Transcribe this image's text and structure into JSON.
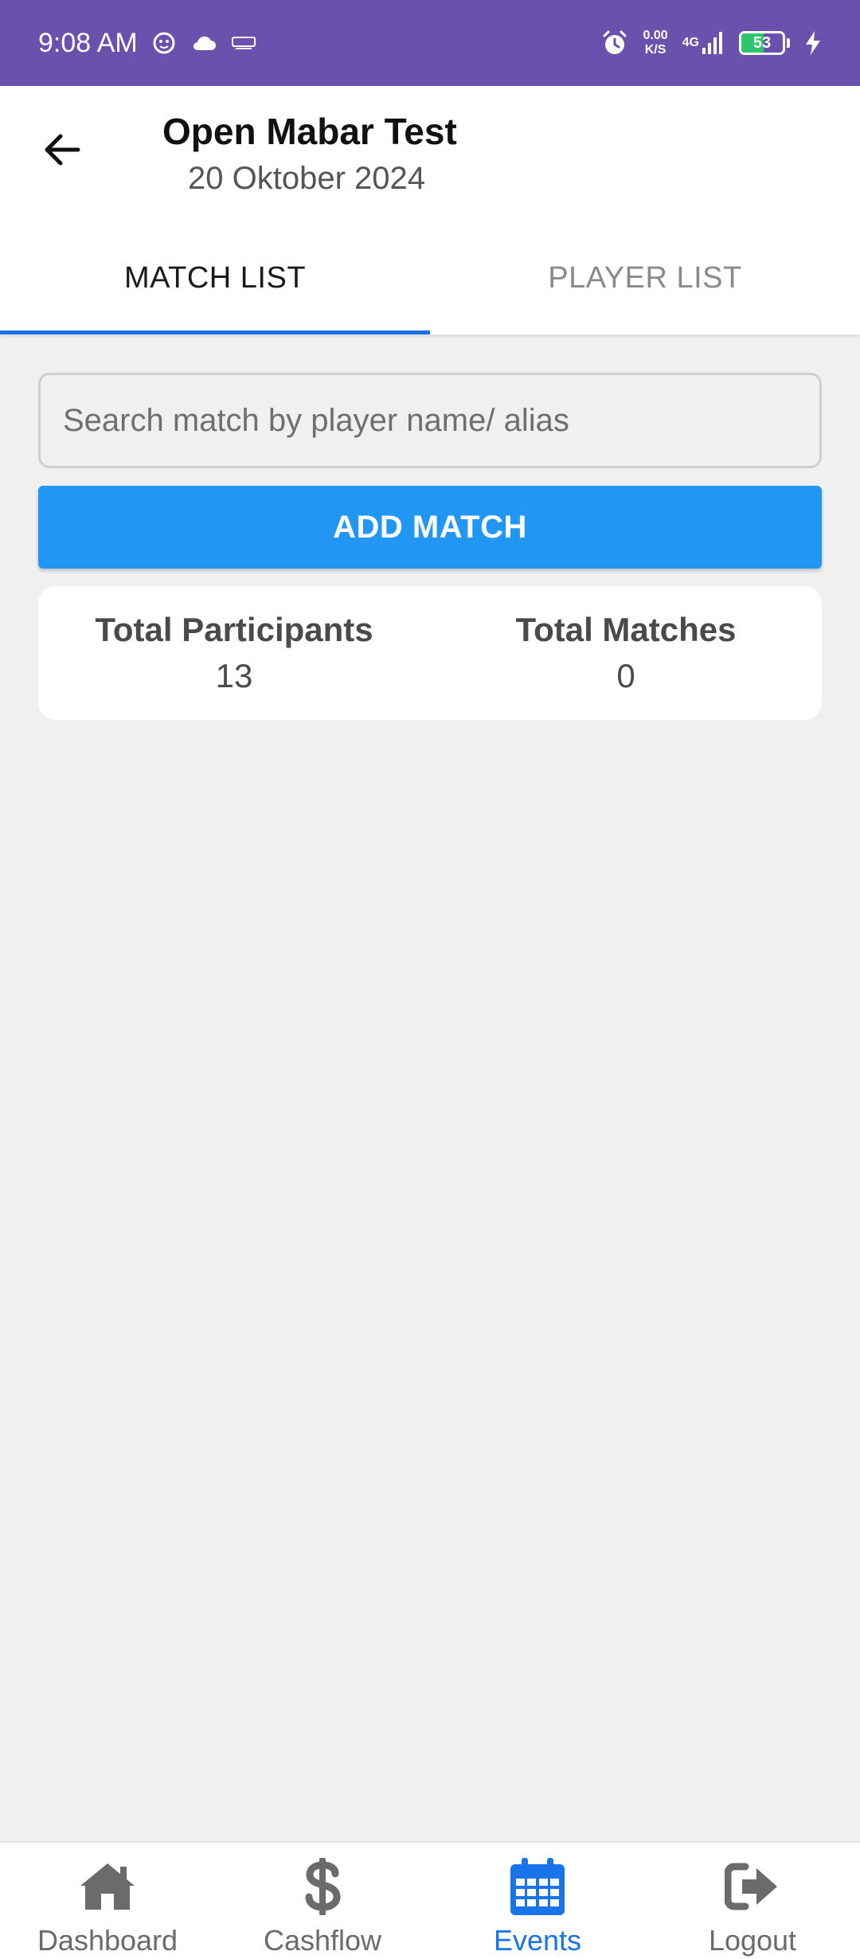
{
  "status_bar": {
    "time": "9:08 AM",
    "speed_value": "0.00",
    "speed_unit": "K/S",
    "network": "4G",
    "battery": "53",
    "battery_level": 0.53,
    "color": "#6a51ae"
  },
  "header": {
    "title": "Open Mabar Test",
    "subtitle": "20 Oktober 2024"
  },
  "tabs": [
    {
      "label": "MATCH LIST",
      "active": true
    },
    {
      "label": "PLAYER LIST",
      "active": false
    }
  ],
  "search": {
    "placeholder": "Search match by player name/ alias",
    "value": ""
  },
  "add_match": {
    "label": "ADD MATCH",
    "color": "#2196f3"
  },
  "stats": {
    "participants_label": "Total Participants",
    "participants_value": "13",
    "matches_label": "Total Matches",
    "matches_value": "0"
  },
  "bottom_nav": {
    "active_color": "#1a73e8",
    "items": [
      {
        "label": "Dashboard",
        "icon": "home-icon",
        "active": false
      },
      {
        "label": "Cashflow",
        "icon": "dollar-icon",
        "active": false
      },
      {
        "label": "Events",
        "icon": "calendar-icon",
        "active": true
      },
      {
        "label": "Logout",
        "icon": "logout-icon",
        "active": false
      }
    ]
  }
}
